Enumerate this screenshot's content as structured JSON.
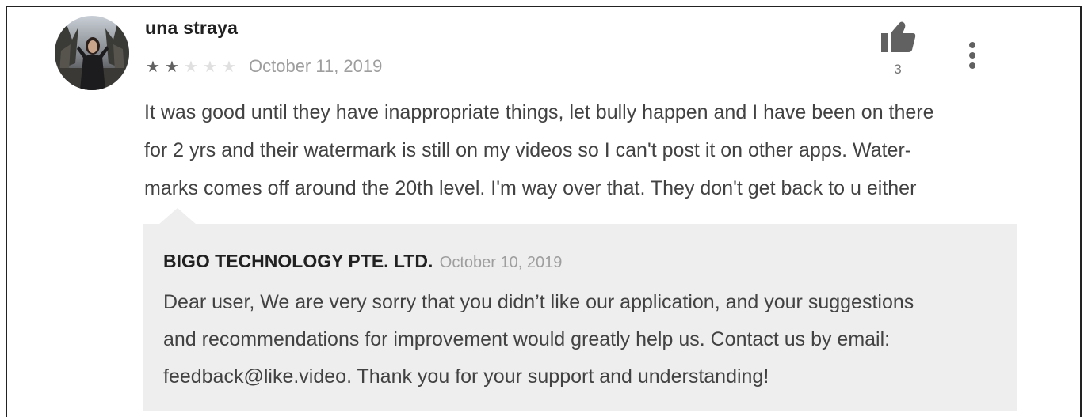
{
  "review": {
    "author": "una straya",
    "rating": 2,
    "rating_max": 5,
    "date": "October 11, 2019",
    "helpful_count": "3",
    "lines": [
      "It was good until they have inappropriate things, let bully happen and I have been on there",
      "for 2 yrs and their watermark is still on my videos so I can't post it on other apps. Water-",
      "marks comes off around the 20th level. I'm way over that. They don't get back to u either"
    ],
    "icons": {
      "helpful": "thumbs-up-icon",
      "menu": "more-vertical-icon",
      "star": "star-icon"
    }
  },
  "reply": {
    "developer": "BIGO TECHNOLOGY PTE. LTD.",
    "date": "October 10, 2019",
    "lines": [
      "Dear user, We are very sorry that you didn’t like our application, and your suggestions",
      "and recommendations for improvement would greatly help us. Contact us by email:",
      "feedback@like.video. Thank you for your support and understanding!"
    ]
  },
  "colors": {
    "star_filled": "#616161",
    "star_empty": "#e0e0e0",
    "reply_background": "#eeeeee",
    "text_secondary": "#9e9e9e"
  }
}
